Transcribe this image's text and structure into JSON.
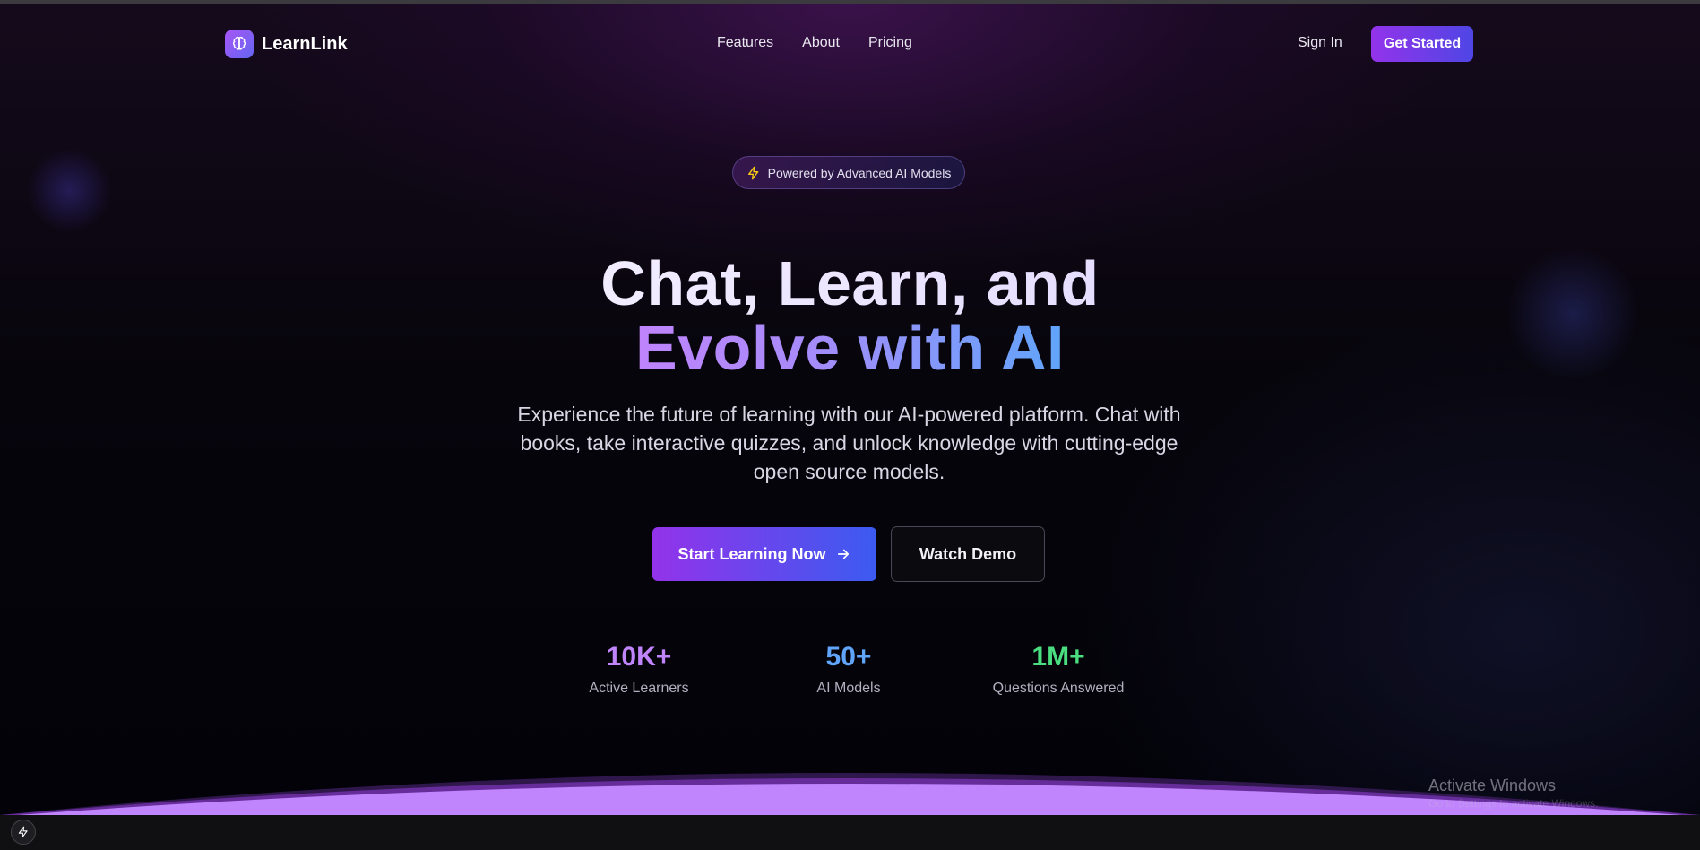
{
  "brand": {
    "name": "LearnLink",
    "logo_icon": "brain-icon"
  },
  "nav": {
    "links": [
      "Features",
      "About",
      "Pricing"
    ],
    "sign_in": "Sign In",
    "get_started": "Get Started"
  },
  "badge": {
    "icon": "lightning-icon",
    "text": "Powered by Advanced AI Models"
  },
  "hero": {
    "title_line1": "Chat, Learn, and",
    "title_line2": "Evolve with AI",
    "subtitle": "Experience the future of learning with our AI-powered platform. Chat with books, take interactive quizzes, and unlock knowledge with cutting-edge open source models.",
    "primary_cta": "Start Learning Now",
    "secondary_cta": "Watch Demo"
  },
  "stats": [
    {
      "value": "10K+",
      "label": "Active Learners",
      "color": "#c084fc"
    },
    {
      "value": "50+",
      "label": "AI Models",
      "color": "#60a5fa"
    },
    {
      "value": "1M+",
      "label": "Questions Answered",
      "color": "#4ade80"
    }
  ],
  "watermark": {
    "line1": "Activate Windows",
    "line2": "Go to Settings to activate Windows."
  },
  "colors": {
    "accent_purple": "#9333ea",
    "accent_blue": "#4f46e5",
    "arc": "#c084fc"
  }
}
